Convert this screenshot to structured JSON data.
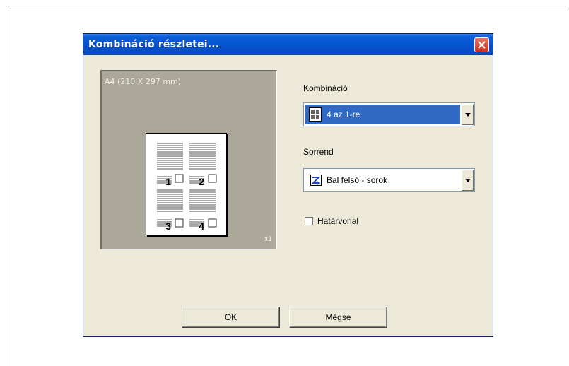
{
  "dialog": {
    "title": "Kombináció részletei..."
  },
  "preview": {
    "paper_size": "A4  (210 X 297 mm)",
    "scale": "x1",
    "page_numbers": [
      "1",
      "2",
      "3",
      "4"
    ]
  },
  "combination": {
    "label": "Kombináció",
    "selected": "4 az 1-re",
    "icon": "four-up-layout-icon"
  },
  "order": {
    "label": "Sorrend",
    "selected": "Bal felső - sorok",
    "icon": "z-order-icon"
  },
  "border": {
    "label": "Határvonal",
    "checked": false
  },
  "buttons": {
    "ok": "OK",
    "cancel": "Mégse"
  },
  "colors": {
    "titlebar": "#0553d0",
    "selection": "#316ac5",
    "dialog_bg": "#ece9d8",
    "preview_bg": "#aca899"
  }
}
